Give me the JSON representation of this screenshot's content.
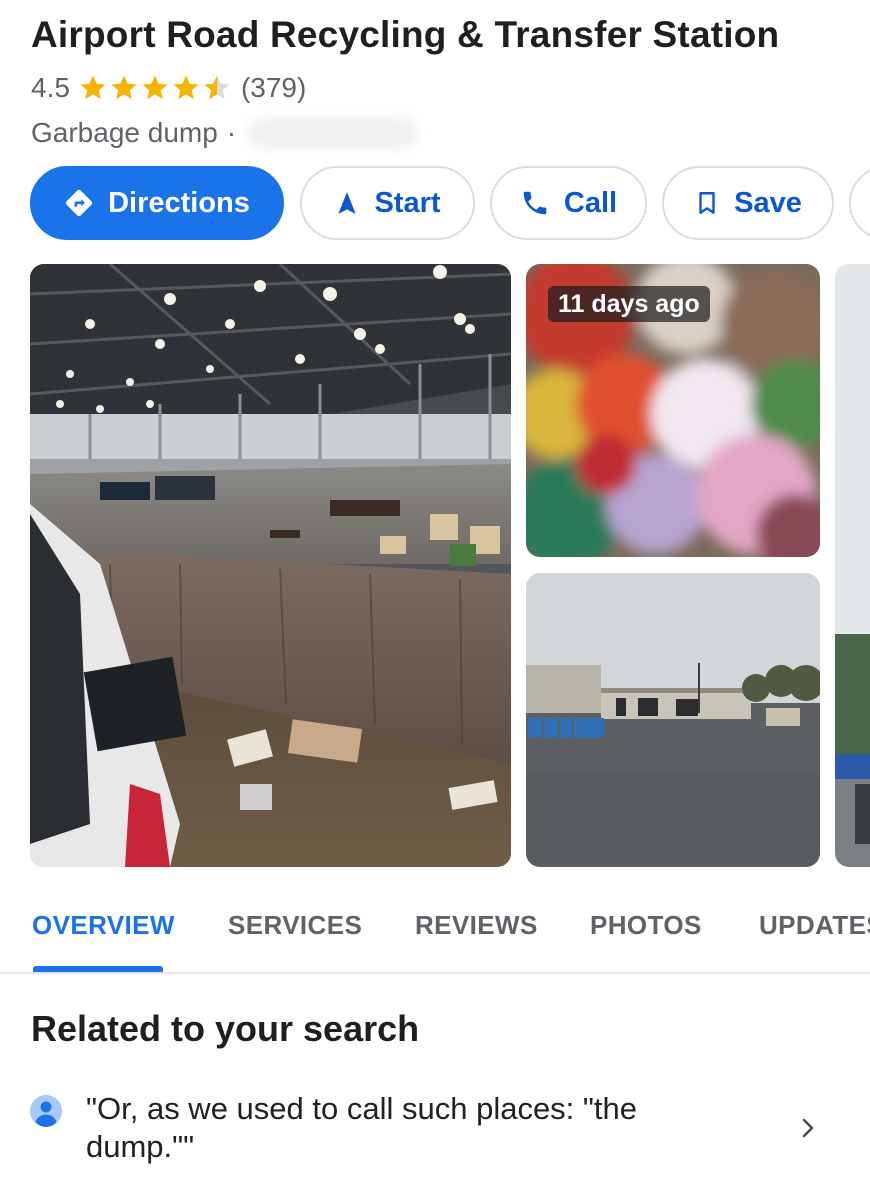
{
  "place": {
    "name": "Airport Road Recycling & Transfer Station",
    "rating": "4.5",
    "rating_value": 4.5,
    "review_count": "(379)",
    "category": "Garbage dump",
    "separator": "·"
  },
  "actions": [
    {
      "label": "Directions",
      "icon": "directions-icon"
    },
    {
      "label": "Start",
      "icon": "navigation-arrow-icon"
    },
    {
      "label": "Call",
      "icon": "phone-icon"
    },
    {
      "label": "Save",
      "icon": "bookmark-icon"
    }
  ],
  "photos": {
    "top_right_badge": "11 days ago"
  },
  "tabs": [
    {
      "label": "OVERVIEW",
      "active": true
    },
    {
      "label": "SERVICES"
    },
    {
      "label": "REVIEWS"
    },
    {
      "label": "PHOTOS"
    },
    {
      "label": "UPDATES"
    }
  ],
  "related": {
    "title": "Related to your search",
    "items": [
      {
        "text": "\"Or, as we used to call such places: \"the dump.\"\"",
        "icon": "person-avatar-icon"
      }
    ]
  },
  "colors": {
    "accent": "#1a73e8",
    "star": "#f4b400",
    "muted_text": "#5f6368"
  }
}
